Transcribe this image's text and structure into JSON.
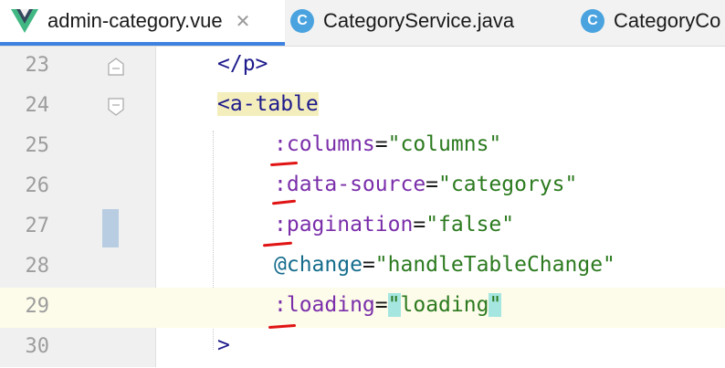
{
  "tabs": [
    {
      "label": "admin-category.vue",
      "icon": "vue-icon",
      "active": true,
      "close": "✕"
    },
    {
      "label": "CategoryService.java",
      "icon": "class-icon",
      "icon_letter": "C",
      "active": false
    },
    {
      "label": "CategoryCo",
      "icon": "class-icon",
      "icon_letter": "C",
      "active": false
    }
  ],
  "lines": [
    {
      "no": "23",
      "code": "</p>"
    },
    {
      "no": "24",
      "code": "<a-table"
    },
    {
      "no": "25",
      "attr": ":columns",
      "value": "\"columns\""
    },
    {
      "no": "26",
      "attr": ":data-source",
      "value": "\"categorys\""
    },
    {
      "no": "27",
      "attr": ":pagination",
      "value": "\"false\""
    },
    {
      "no": "28",
      "attr": "@change",
      "value": "\"handleTableChange\""
    },
    {
      "no": "29",
      "attr": ":loading",
      "quote_open": "\"",
      "value": "loading",
      "quote_close": "\""
    },
    {
      "no": "30",
      "code": ">"
    }
  ],
  "colors": {
    "accent": "#3d82e0",
    "annotation": "#e01414",
    "string": "#2c7a1f",
    "bound_attr": "#7a2eaa"
  }
}
